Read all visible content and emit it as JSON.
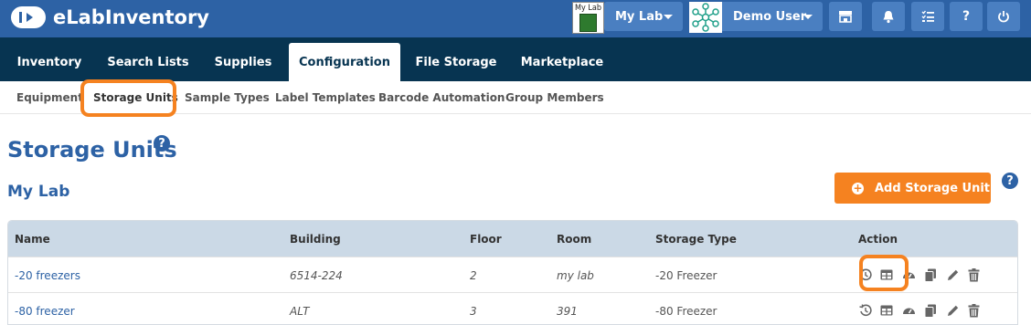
{
  "app": {
    "name": "eLabInventory"
  },
  "topbar": {
    "lab_thumb_text": "My Lab",
    "lab_dropdown": "My Lab",
    "user_dropdown": "Demo User",
    "icons": [
      "store-icon",
      "bell-icon",
      "checklist-icon",
      "help-icon",
      "power-icon"
    ]
  },
  "main_nav": {
    "tabs": [
      {
        "label": "Inventory"
      },
      {
        "label": "Search Lists"
      },
      {
        "label": "Supplies"
      },
      {
        "label": "Configuration",
        "active": true
      },
      {
        "label": "File Storage"
      },
      {
        "label": "Marketplace"
      }
    ]
  },
  "sub_nav": {
    "items": [
      {
        "label": "Equipment"
      },
      {
        "label": "Storage Units",
        "active": true
      },
      {
        "label": "Sample Types"
      },
      {
        "label": "Label Templates"
      },
      {
        "label": "Barcode Automation"
      },
      {
        "label": "Group Members"
      }
    ]
  },
  "page": {
    "title": "Storage Units",
    "section_title": "My Lab",
    "add_button": "Add Storage Unit",
    "help_glyph": "?"
  },
  "table": {
    "columns": [
      "Name",
      "Building",
      "Floor",
      "Room",
      "Storage Type",
      "Action"
    ],
    "rows": [
      {
        "name": "-20 freezers",
        "building": "6514-224",
        "floor": "2",
        "room": "my lab",
        "storage_type": "-20 Freezer"
      },
      {
        "name": "-80 freezer",
        "building": "ALT",
        "floor": "3",
        "room": "391",
        "storage_type": "-80 Freezer"
      }
    ],
    "action_icons": [
      "history-icon",
      "layout-icon",
      "dashboard-icon",
      "copy-icon",
      "edit-icon",
      "delete-icon"
    ]
  },
  "colors": {
    "topbar": "#2d62a5",
    "main_nav": "#073451",
    "accent_orange": "#f58220",
    "table_header": "#cbd9e6"
  }
}
